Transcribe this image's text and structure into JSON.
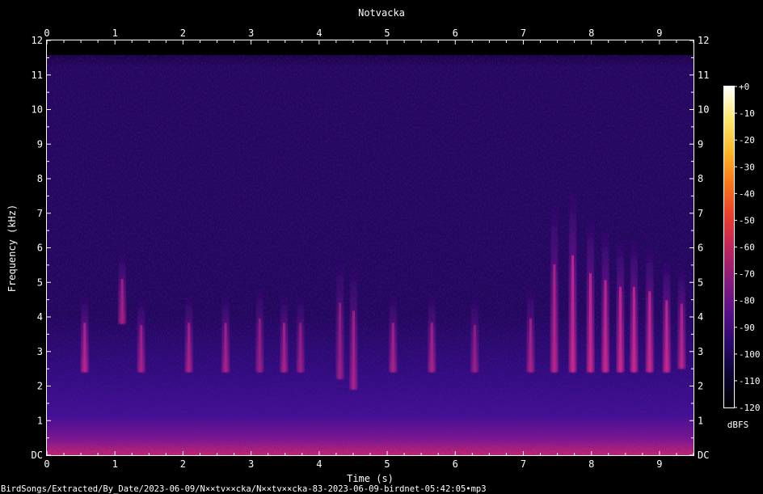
{
  "chart_data": {
    "type": "heatmap",
    "title": "Notvacka",
    "xlabel": "Time (s)",
    "ylabel": "Frequency (kHz)",
    "xlim": [
      0,
      9.5
    ],
    "ylim": [
      0,
      12
    ],
    "x_ticks": [
      "0",
      "1",
      "2",
      "3",
      "4",
      "5",
      "6",
      "7",
      "8",
      "9"
    ],
    "y_ticks": [
      "DC",
      "1",
      "2",
      "3",
      "4",
      "5",
      "6",
      "7",
      "8",
      "9",
      "10",
      "11",
      "12"
    ],
    "colorbar": {
      "label": "dBFS",
      "ticks": [
        "+0",
        "-10",
        "-20",
        "-30",
        "-40",
        "-50",
        "-60",
        "-70",
        "-80",
        "-90",
        "-100",
        "-110",
        "-120"
      ],
      "range": [
        -120,
        0
      ],
      "colors": [
        "#000000",
        "#0a0432",
        "#2a0a6e",
        "#5a0f8a",
        "#8a1a7a",
        "#c0255a",
        "#e8402a",
        "#f8781a",
        "#fcb82a",
        "#fde870",
        "#ffffff"
      ]
    },
    "calls": [
      {
        "t": 0.55,
        "f_low": 2.4,
        "f_high": 4.6,
        "level_db": -78
      },
      {
        "t": 1.1,
        "f_low": 3.8,
        "f_high": 5.8,
        "level_db": -80
      },
      {
        "t": 1.38,
        "f_low": 2.4,
        "f_high": 4.5,
        "level_db": -80
      },
      {
        "t": 2.08,
        "f_low": 2.4,
        "f_high": 4.6,
        "level_db": -80
      },
      {
        "t": 2.62,
        "f_low": 2.4,
        "f_high": 4.6,
        "level_db": -80
      },
      {
        "t": 3.12,
        "f_low": 2.4,
        "f_high": 4.8,
        "level_db": -82
      },
      {
        "t": 3.48,
        "f_low": 2.4,
        "f_high": 4.6,
        "level_db": -80
      },
      {
        "t": 3.72,
        "f_low": 2.4,
        "f_high": 4.6,
        "level_db": -82
      },
      {
        "t": 4.3,
        "f_low": 2.2,
        "f_high": 5.6,
        "level_db": -82
      },
      {
        "t": 4.5,
        "f_low": 1.9,
        "f_high": 5.4,
        "level_db": -80
      },
      {
        "t": 5.08,
        "f_low": 2.4,
        "f_high": 4.6,
        "level_db": -80
      },
      {
        "t": 5.65,
        "f_low": 2.4,
        "f_high": 4.6,
        "level_db": -80
      },
      {
        "t": 6.28,
        "f_low": 2.4,
        "f_high": 4.5,
        "level_db": -82
      },
      {
        "t": 7.1,
        "f_low": 2.4,
        "f_high": 4.8,
        "level_db": -80
      },
      {
        "t": 7.45,
        "f_low": 2.4,
        "f_high": 7.2,
        "level_db": -78
      },
      {
        "t": 7.72,
        "f_low": 2.4,
        "f_high": 7.6,
        "level_db": -76
      },
      {
        "t": 7.98,
        "f_low": 2.4,
        "f_high": 6.8,
        "level_db": -76
      },
      {
        "t": 8.2,
        "f_low": 2.4,
        "f_high": 6.5,
        "level_db": -76
      },
      {
        "t": 8.42,
        "f_low": 2.4,
        "f_high": 6.2,
        "level_db": -76
      },
      {
        "t": 8.62,
        "f_low": 2.4,
        "f_high": 6.2,
        "level_db": -76
      },
      {
        "t": 8.85,
        "f_low": 2.4,
        "f_high": 6.0,
        "level_db": -76
      },
      {
        "t": 9.1,
        "f_low": 2.4,
        "f_high": 5.6,
        "level_db": -76
      },
      {
        "t": 9.32,
        "f_low": 2.5,
        "f_high": 5.4,
        "level_db": -78
      }
    ],
    "grid": false
  },
  "footer": {
    "file_path": "BirdSongs/Extracted/By_Date/2023-06-09/N××tv××cka/N××tv××cka-83-2023-06-09-birdnet-05:42:05•mp3"
  }
}
